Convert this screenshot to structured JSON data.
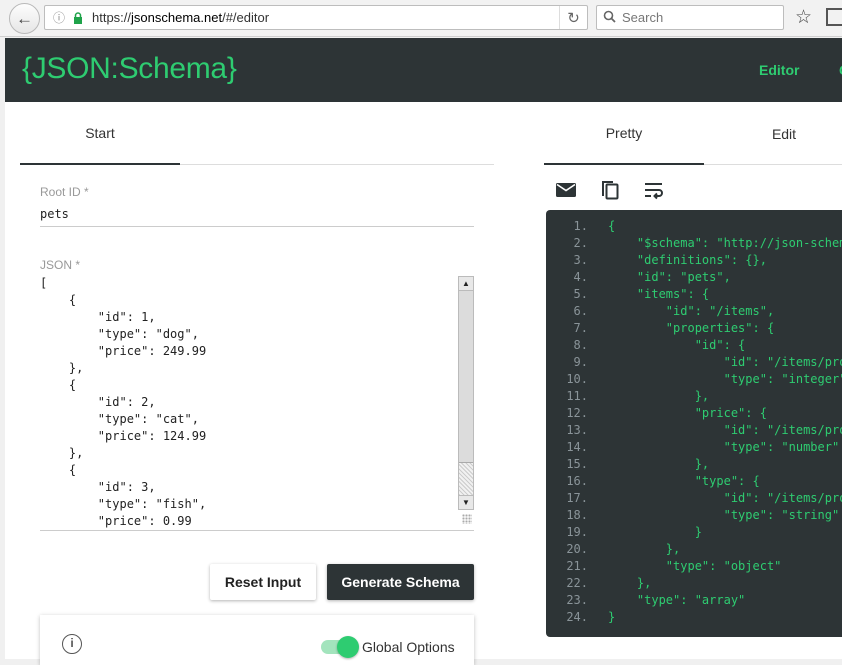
{
  "browser": {
    "url_prefix": "https://",
    "url_domain": "jsonschema.net",
    "url_path": "/#/editor",
    "search_placeholder": "Search"
  },
  "header": {
    "logo": "{JSON:Schema}",
    "nav_editor": "Editor",
    "nav_next": "C"
  },
  "left": {
    "tab_start": "Start",
    "rootid_label": "Root ID *",
    "rootid_value": "pets",
    "json_label": "JSON *",
    "json_value": "[\n    {\n        \"id\": 1,\n        \"type\": \"dog\",\n        \"price\": 249.99\n    },\n    {\n        \"id\": 2,\n        \"type\": \"cat\",\n        \"price\": 124.99\n    },\n    {\n        \"id\": 3,\n        \"type\": \"fish\",\n        \"price\": 0.99",
    "reset_label": "Reset Input",
    "generate_label": "Generate Schema",
    "options_label": "Global Options",
    "options_enabled": true
  },
  "right": {
    "tab_pretty": "Pretty",
    "tab_edit": "Edit",
    "code_lines": [
      "{",
      "    \"$schema\": \"http://json-schem",
      "    \"definitions\": {},",
      "    \"id\": \"pets\",",
      "    \"items\": {",
      "        \"id\": \"/items\",",
      "        \"properties\": {",
      "            \"id\": {",
      "                \"id\": \"/items/pro",
      "                \"type\": \"integer\"",
      "            },",
      "            \"price\": {",
      "                \"id\": \"/items/pro",
      "                \"type\": \"number\"",
      "            },",
      "            \"type\": {",
      "                \"id\": \"/items/pro",
      "                \"type\": \"string\"",
      "            }",
      "        },",
      "        \"type\": \"object\"",
      "    },",
      "    \"type\": \"array\"",
      "}"
    ]
  },
  "colors": {
    "accent": "#2ecc71",
    "dark": "#2d3436"
  }
}
